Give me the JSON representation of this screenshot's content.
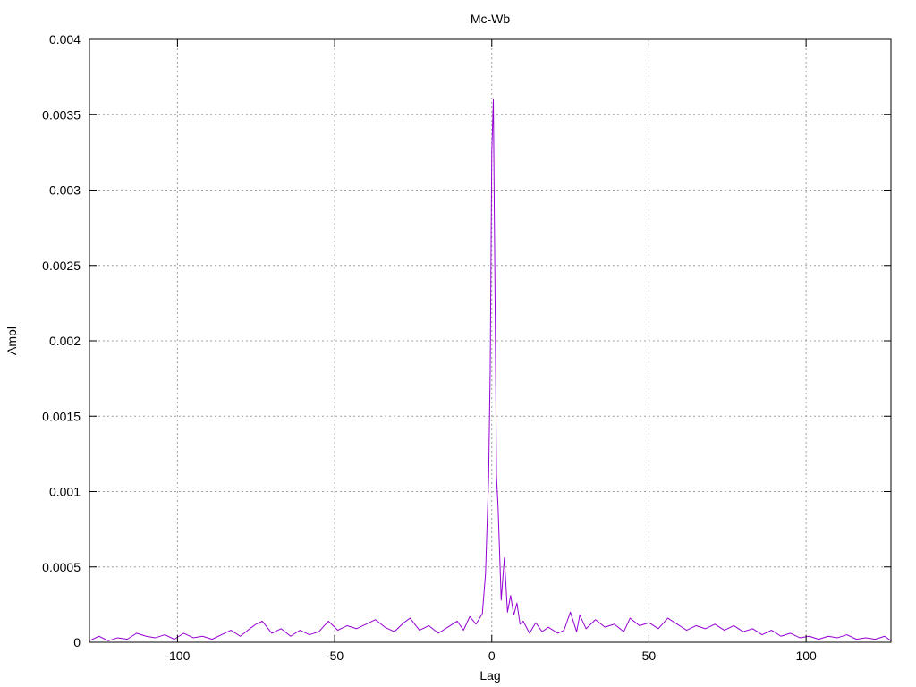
{
  "chart_data": {
    "type": "line",
    "title": "Mc-Wb",
    "xlabel": "Lag",
    "ylabel": "Ampl",
    "xlim": [
      -128,
      127
    ],
    "ylim": [
      0,
      0.004
    ],
    "grid": true,
    "x_ticks": [
      -100,
      -50,
      0,
      50,
      100
    ],
    "x_tick_labels": [
      "-100",
      "-50",
      "0",
      "50",
      "100"
    ],
    "y_ticks": [
      0,
      0.0005,
      0.001,
      0.0015,
      0.002,
      0.0025,
      0.003,
      0.0035,
      0.004
    ],
    "y_tick_labels": [
      "0",
      "0.0005",
      "0.001",
      "0.0015",
      "0.002",
      "0.0025",
      "0.003",
      "0.0035",
      "0.004"
    ],
    "series": [
      {
        "color": "#9400d3",
        "points": [
          [
            -128,
            1e-05
          ],
          [
            -125,
            4e-05
          ],
          [
            -122,
            1e-05
          ],
          [
            -119,
            3e-05
          ],
          [
            -116,
            2e-05
          ],
          [
            -113,
            6e-05
          ],
          [
            -110,
            4e-05
          ],
          [
            -107,
            3e-05
          ],
          [
            -104,
            5e-05
          ],
          [
            -101,
            2e-05
          ],
          [
            -98,
            6e-05
          ],
          [
            -95,
            3e-05
          ],
          [
            -92,
            4e-05
          ],
          [
            -89,
            2e-05
          ],
          [
            -86,
            5e-05
          ],
          [
            -83,
            8e-05
          ],
          [
            -80,
            4e-05
          ],
          [
            -77,
            9e-05
          ],
          [
            -75,
            0.00012
          ],
          [
            -73,
            0.00014
          ],
          [
            -70,
            6e-05
          ],
          [
            -67,
            9e-05
          ],
          [
            -64,
            4e-05
          ],
          [
            -61,
            8e-05
          ],
          [
            -58,
            5e-05
          ],
          [
            -55,
            7e-05
          ],
          [
            -52,
            0.00014
          ],
          [
            -49,
            8e-05
          ],
          [
            -46,
            0.00011
          ],
          [
            -43,
            9e-05
          ],
          [
            -40,
            0.00012
          ],
          [
            -37,
            0.00015
          ],
          [
            -34,
            0.0001
          ],
          [
            -31,
            7e-05
          ],
          [
            -28,
            0.00013
          ],
          [
            -26,
            0.00016
          ],
          [
            -23,
            8e-05
          ],
          [
            -20,
            0.00011
          ],
          [
            -17,
            6e-05
          ],
          [
            -14,
            0.0001
          ],
          [
            -11,
            0.00014
          ],
          [
            -9,
            8e-05
          ],
          [
            -7,
            0.00017
          ],
          [
            -5,
            0.00012
          ],
          [
            -3,
            0.00019
          ],
          [
            -2,
            0.00045
          ],
          [
            -1,
            0.0011
          ],
          [
            -0.5,
            0.0018
          ],
          [
            0,
            0.00325
          ],
          [
            0.5,
            0.0036
          ],
          [
            1,
            0.0024
          ],
          [
            1.5,
            0.0011
          ],
          [
            2,
            0.0009
          ],
          [
            3,
            0.00028
          ],
          [
            4,
            0.00056
          ],
          [
            5,
            0.0002
          ],
          [
            6,
            0.00031
          ],
          [
            7,
            0.00018
          ],
          [
            8,
            0.00026
          ],
          [
            9,
            0.00012
          ],
          [
            10,
            0.00014
          ],
          [
            12,
            6e-05
          ],
          [
            14,
            0.00013
          ],
          [
            16,
            7e-05
          ],
          [
            18,
            0.0001
          ],
          [
            21,
            6e-05
          ],
          [
            23,
            8e-05
          ],
          [
            25,
            0.0002
          ],
          [
            27,
            7e-05
          ],
          [
            28,
            0.00018
          ],
          [
            30,
            9e-05
          ],
          [
            33,
            0.00015
          ],
          [
            36,
            0.0001
          ],
          [
            39,
            0.00012
          ],
          [
            42,
            7e-05
          ],
          [
            44,
            0.00016
          ],
          [
            47,
            0.00011
          ],
          [
            50,
            0.00013
          ],
          [
            53,
            9e-05
          ],
          [
            56,
            0.00016
          ],
          [
            59,
            0.00012
          ],
          [
            62,
            8e-05
          ],
          [
            65,
            0.00011
          ],
          [
            68,
            9e-05
          ],
          [
            71,
            0.00012
          ],
          [
            74,
            8e-05
          ],
          [
            77,
            0.00011
          ],
          [
            80,
            7e-05
          ],
          [
            83,
            9e-05
          ],
          [
            86,
            5e-05
          ],
          [
            89,
            8e-05
          ],
          [
            92,
            4e-05
          ],
          [
            95,
            6e-05
          ],
          [
            98,
            3e-05
          ],
          [
            101,
            4e-05
          ],
          [
            104,
            2e-05
          ],
          [
            107,
            4e-05
          ],
          [
            110,
            3e-05
          ],
          [
            113,
            5e-05
          ],
          [
            116,
            2e-05
          ],
          [
            119,
            3e-05
          ],
          [
            122,
            2e-05
          ],
          [
            125,
            4e-05
          ],
          [
            127,
            1e-05
          ]
        ]
      }
    ]
  }
}
